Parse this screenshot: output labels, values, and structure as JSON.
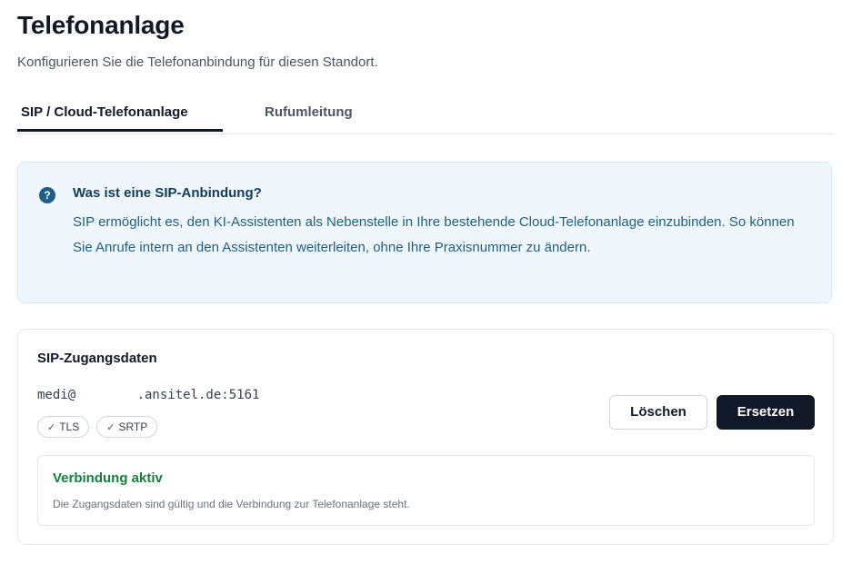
{
  "page": {
    "title": "Telefonanlage",
    "subtitle": "Konfigurieren Sie die Telefonanbindung für diesen Standort."
  },
  "tabs": [
    {
      "label": "SIP / Cloud-Telefonanlage",
      "active": true
    },
    {
      "label": "Rufumleitung",
      "active": false
    }
  ],
  "info": {
    "icon": "question-circle-icon",
    "title": "Was ist eine SIP-Anbindung?",
    "text": "SIP ermöglicht es, den KI-Assistenten als Nebenstelle in Ihre bestehende Cloud-Telefonanlage einzubinden. So können Sie Anrufe intern an den Assistenten weiterleiten, ohne Ihre Praxisnummer zu ändern."
  },
  "sip": {
    "title": "SIP-Zugangsdaten",
    "address": "medi@        .ansitel.de:5161",
    "badges": [
      {
        "label": "TLS",
        "icon": "check-icon"
      },
      {
        "label": "SRTP",
        "icon": "check-icon"
      }
    ],
    "delete_label": "Löschen",
    "replace_label": "Ersetzen",
    "status": {
      "title": "Verbindung aktiv",
      "text": "Die Zugangsdaten sind gültig und die Verbindung zur Telefonanlage steht.",
      "color": "#15803d"
    }
  },
  "colors": {
    "accent": "#111827",
    "info_bg": "#f0f7fc",
    "info_text": "#1e5f85",
    "success": "#15803d"
  }
}
